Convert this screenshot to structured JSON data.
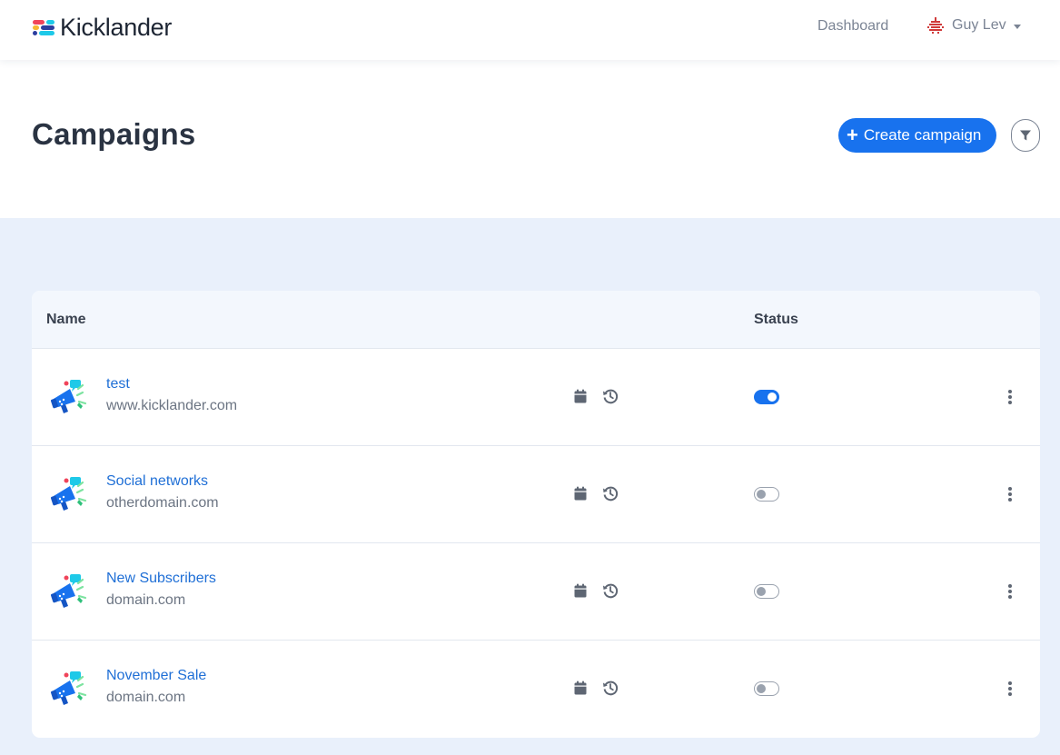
{
  "brand": {
    "name": "Kicklander",
    "colors": [
      "#f0445a",
      "#f7b733",
      "#2c3e9f",
      "#1ec9e8"
    ]
  },
  "nav": {
    "dashboard_label": "Dashboard",
    "user_name": "Guy Lev"
  },
  "page": {
    "title": "Campaigns",
    "create_label": "Create campaign"
  },
  "table": {
    "columns": {
      "name": "Name",
      "status": "Status"
    },
    "rows": [
      {
        "name": "test",
        "domain": "www.kicklander.com",
        "active": true
      },
      {
        "name": "Social networks",
        "domain": "otherdomain.com",
        "active": false
      },
      {
        "name": "New Subscribers",
        "domain": "domain.com",
        "active": false
      },
      {
        "name": "November Sale",
        "domain": "domain.com",
        "active": false
      }
    ]
  },
  "icons": {
    "campaign": "megaphone-icon",
    "schedule": "calendar-icon",
    "history": "history-icon",
    "menu": "more-vertical-icon",
    "filter": "filter-icon"
  },
  "accent": "#1872ee"
}
